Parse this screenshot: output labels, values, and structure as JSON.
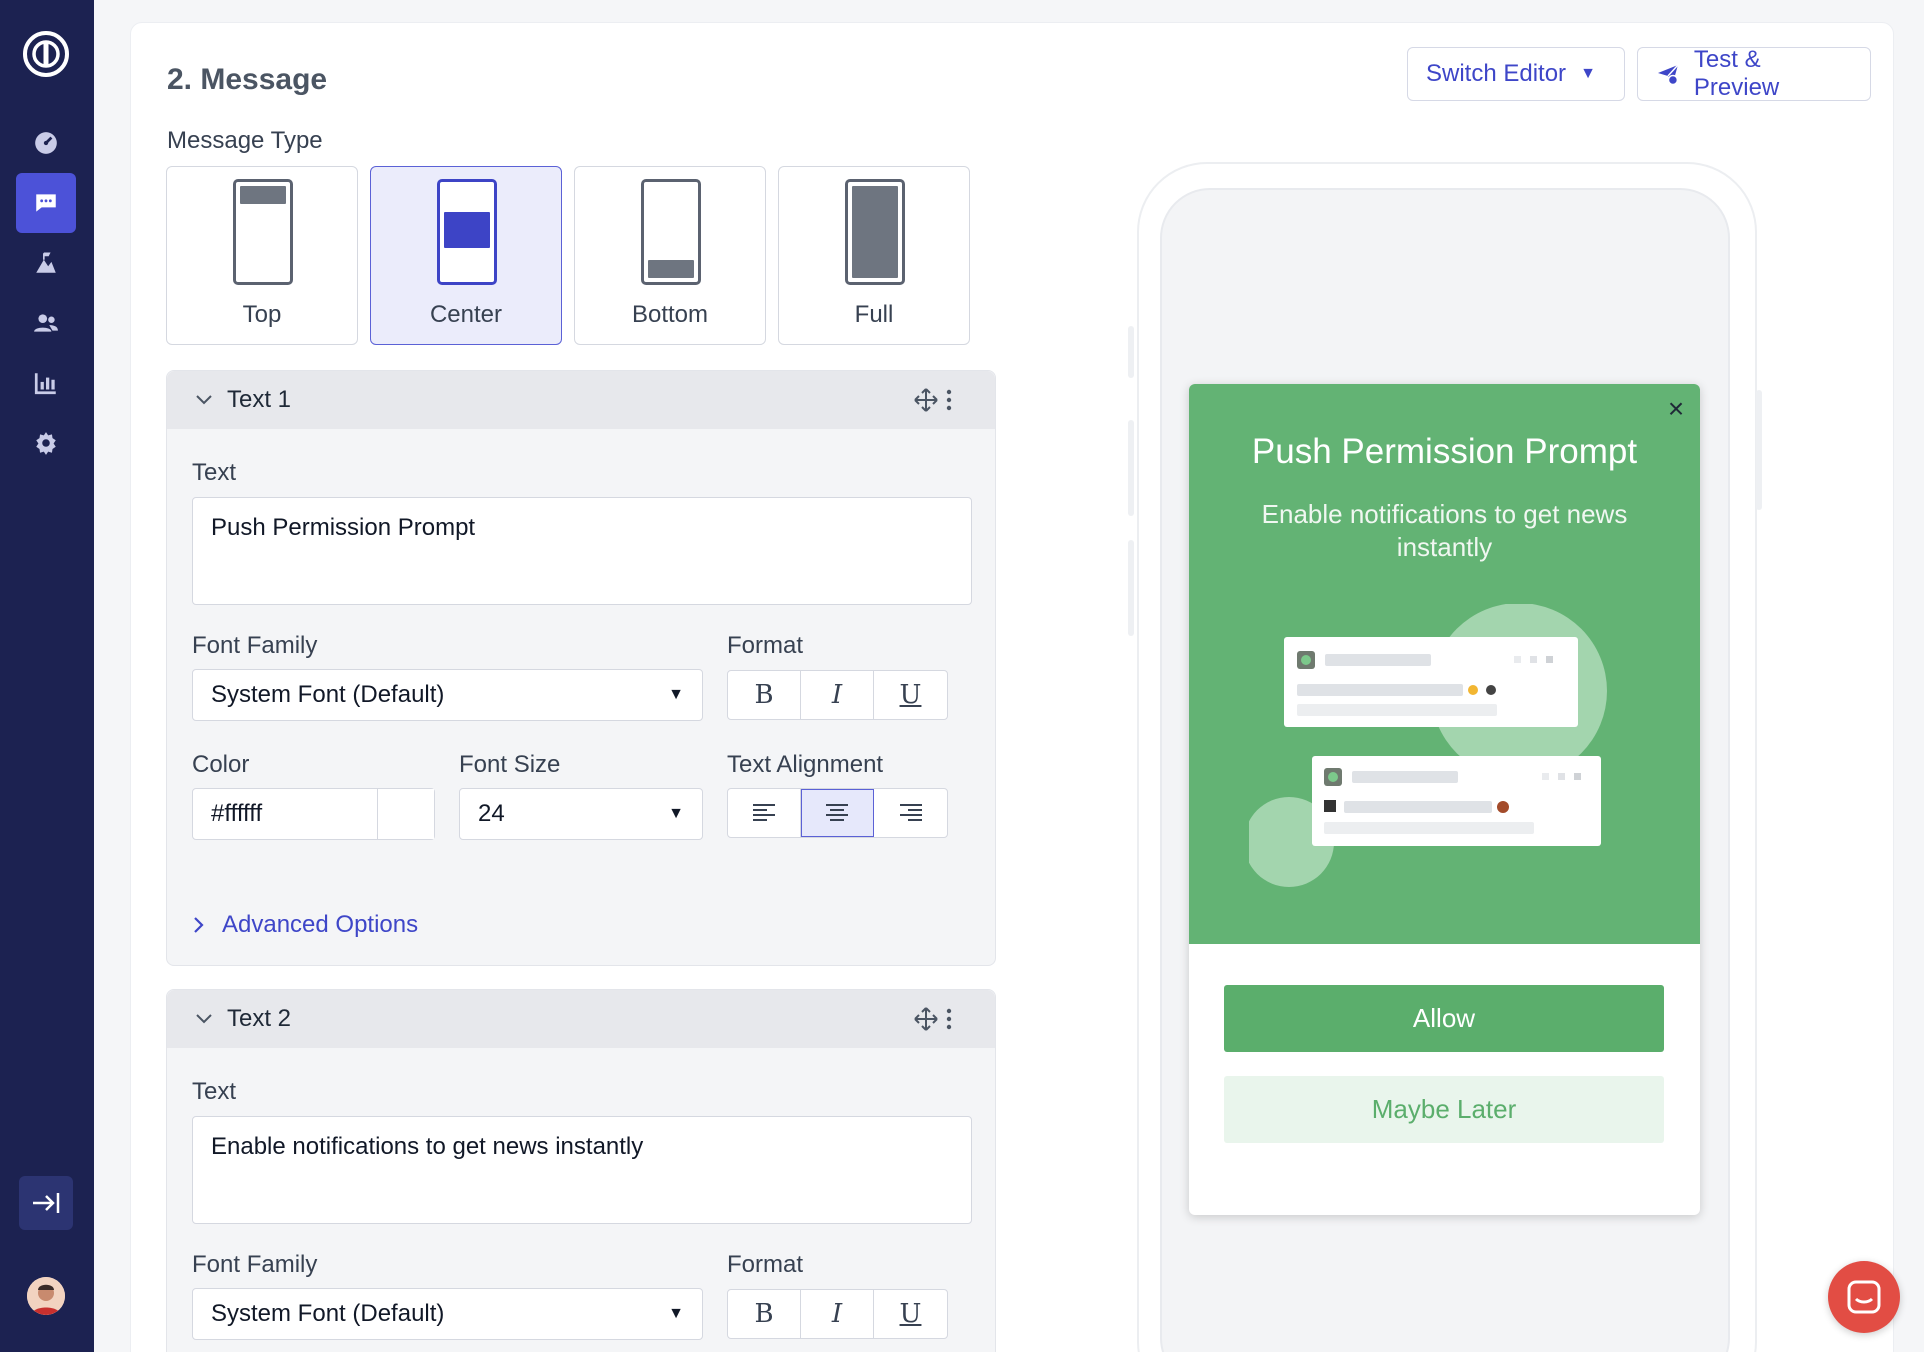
{
  "section": {
    "title": "2. Message"
  },
  "toolbar": {
    "switch_editor": "Switch Editor",
    "test_preview": "Test & Preview"
  },
  "message_type": {
    "label": "Message Type",
    "options": [
      "Top",
      "Center",
      "Bottom",
      "Full"
    ],
    "selected": "Center"
  },
  "panels": [
    {
      "title": "Text 1",
      "text_label": "Text",
      "text_value": "Push Permission Prompt",
      "font_family_label": "Font Family",
      "font_family_value": "System Font (Default)",
      "format_label": "Format",
      "color_label": "Color",
      "color_value": "#ffffff",
      "font_size_label": "Font Size",
      "font_size_value": "24",
      "alignment_label": "Text Alignment",
      "alignment_selected": "center",
      "advanced_label": "Advanced Options"
    },
    {
      "title": "Text 2",
      "text_label": "Text",
      "text_value": "Enable notifications to get news instantly",
      "font_family_label": "Font Family",
      "font_family_value": "System Font (Default)",
      "format_label": "Format"
    }
  ],
  "format_buttons": {
    "bold": "B",
    "italic": "I",
    "underline": "U"
  },
  "preview": {
    "title": "Push Permission Prompt",
    "subtitle": "Enable notifications to get news instantly",
    "allow": "Allow",
    "later": "Maybe Later",
    "close": "×",
    "header_color": "#63b374",
    "button_color": "#5bae6c"
  },
  "colors": {
    "sidebar": "#1c2251",
    "accent": "#3e46c8",
    "active_nav": "#4c52d8",
    "chat": "#e24d44"
  }
}
